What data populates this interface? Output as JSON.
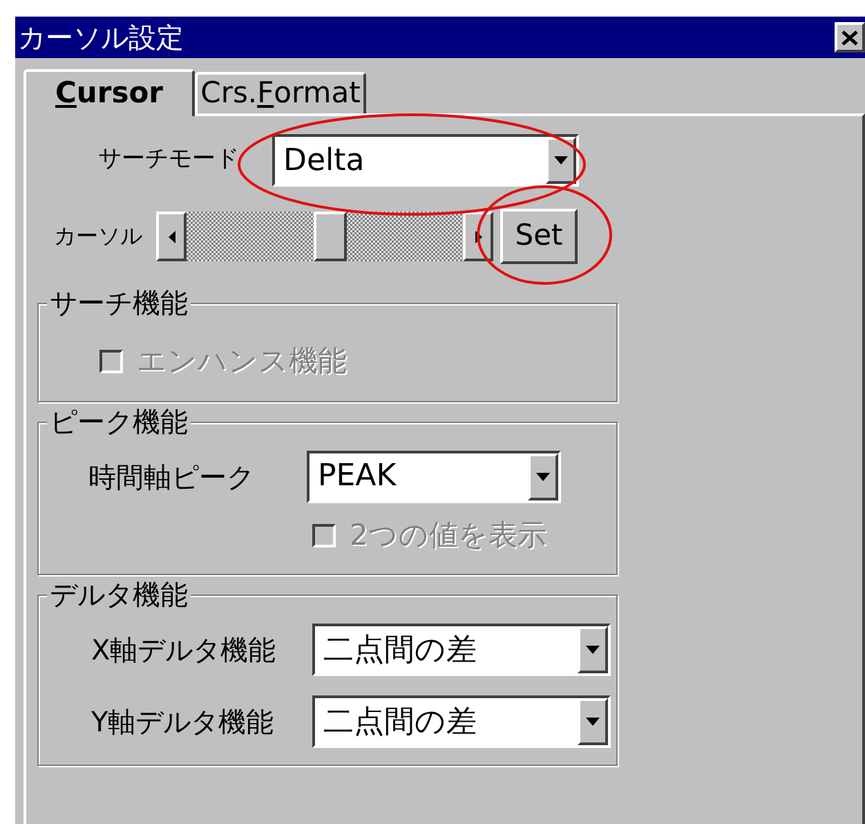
{
  "window": {
    "title": "カーソル設定"
  },
  "tabs": [
    {
      "key": "C",
      "post": "ursor",
      "selected": true
    },
    {
      "pre": "Crs.",
      "key": "F",
      "post": "ormat",
      "selected": false
    }
  ],
  "search_mode": {
    "label": "サーチモード",
    "value": "Delta"
  },
  "cursor": {
    "label": "カーソル",
    "level": 0.52,
    "button": "Set"
  },
  "groups": [
    {
      "title": "サーチ機能",
      "rows": [
        {
          "kind": "checkbox",
          "label": "エンハンス機能",
          "checked": false,
          "disabled": true
        }
      ]
    },
    {
      "title": "ピーク機能",
      "rows": [
        {
          "kind": "select",
          "label": "時間軸ピーク",
          "value": "PEAK"
        },
        {
          "kind": "checkbox",
          "label": "2つの値を表示",
          "checked": false,
          "disabled": true
        }
      ]
    },
    {
      "title": "デルタ機能",
      "rows": [
        {
          "kind": "select",
          "label": "X軸デルタ機能",
          "value": "二点間の差"
        },
        {
          "kind": "select",
          "label": "Y軸デルタ機能",
          "value": "二点間の差"
        }
      ]
    }
  ]
}
